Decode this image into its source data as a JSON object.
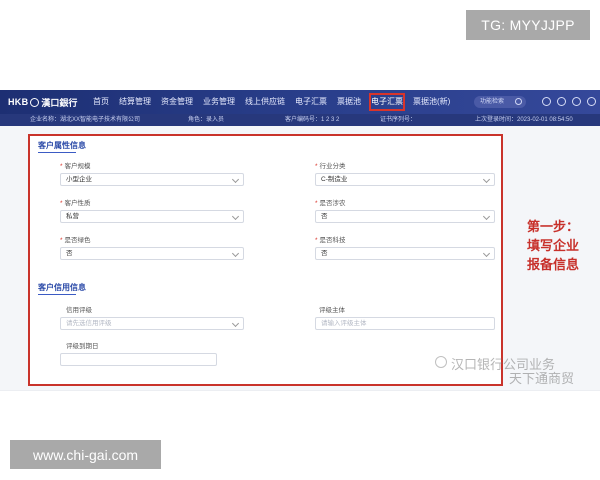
{
  "watermarks": {
    "top_right": "TG: MYYJJPP",
    "bottom_left": "www.chi-gai.com",
    "wechat_line1": "汉口银行公司业务",
    "wechat_line2": "天下通商贸"
  },
  "navbar": {
    "logo_latin": "HKB",
    "logo_cn": "漢口銀行",
    "items": [
      "首页",
      "结算管理",
      "资金管理",
      "业务管理",
      "线上供应链",
      "电子汇票",
      "票据池",
      "电子汇票",
      "票据池(新)"
    ],
    "search_placeholder": "功能检索"
  },
  "subbar": {
    "company": "企业名称：湖北XX智能电子技术有限公司",
    "role": "角色：录入员",
    "customer_no": "客户编码号：1 2 3 2",
    "cert_no": "证书序列号：",
    "last_login": "上次登录时间：2023-02-01 08:54:50"
  },
  "form": {
    "section1_title": "客户属性信息",
    "section2_title": "客户信用信息",
    "fields": {
      "customer_scale": {
        "label": "客户规模",
        "value": "小型企业"
      },
      "industry": {
        "label": "行业分类",
        "value": "C-制造业"
      },
      "customer_nature": {
        "label": "客户性质",
        "value": "私营"
      },
      "agriculture": {
        "label": "是否涉农",
        "value": "否"
      },
      "green": {
        "label": "是否绿色",
        "value": "否"
      },
      "tech": {
        "label": "是否科技",
        "value": "否"
      },
      "credit_rating": {
        "label": "信用评级",
        "placeholder": "请先选信用评级"
      },
      "rating_agency": {
        "label": "评级主体",
        "placeholder": "请输入评级主体"
      },
      "rating_expiry": {
        "label": "评级到期日"
      }
    }
  },
  "annotation": {
    "line1": "第一步：",
    "line2": "填写企业",
    "line3": "报备信息"
  },
  "colors": {
    "nav_bg": "#1d2f73",
    "highlight_red": "#d9342b",
    "section_blue": "#2b4aa8"
  }
}
